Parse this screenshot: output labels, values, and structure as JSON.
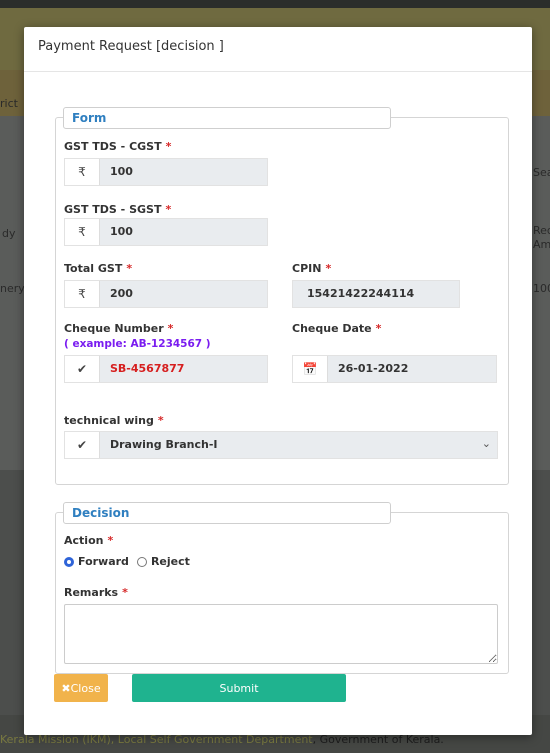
{
  "background": {
    "left_labels": [
      "rict",
      "dy",
      "nery"
    ],
    "right_labels": [
      "Sea",
      "Req",
      "Am",
      "100"
    ],
    "footer": {
      "part1": "Kerala Mission (IKM), Local Self Government Department",
      "part2": ", Government of Kerala."
    }
  },
  "modal": {
    "title": "Payment Request [decision ]",
    "form_legend": "Form",
    "fields": {
      "cgst": {
        "label": "GST TDS - CGST",
        "required": "*",
        "addon": "₹",
        "value": "100"
      },
      "sgst": {
        "label": "GST TDS - SGST",
        "required": "*",
        "addon": "₹",
        "value": "100"
      },
      "total_gst": {
        "label": "Total GST",
        "required": "*",
        "addon": "₹",
        "value": "200"
      },
      "cpin": {
        "label": "CPIN",
        "required": "*",
        "value": "15421422244114"
      },
      "cheque_number": {
        "label": "Cheque Number",
        "required": "*",
        "hint": "( example: AB-1234567 )",
        "addon": "✔",
        "value": "SB-4567877"
      },
      "cheque_date": {
        "label": "Cheque Date",
        "required": "*",
        "addon": "📅",
        "value": "26-01-2022"
      },
      "technical_wing": {
        "label": "technical wing",
        "required": "*",
        "addon": "✔",
        "value": "Drawing Branch-I",
        "chevron": "⌄"
      }
    },
    "decision_legend": "Decision",
    "action": {
      "label": "Action",
      "required": "*",
      "options": [
        "Forward",
        "Reject"
      ],
      "selected": "Forward"
    },
    "remarks": {
      "label": "Remarks",
      "required": "*",
      "value": ""
    },
    "buttons": {
      "close": "✖Close",
      "submit": "Submit"
    }
  },
  "colors": {
    "accent": "#2f7fc0",
    "required": "#d62828",
    "hint": "#7a1cf0",
    "close": "#f1b34b",
    "submit": "#1fb38f"
  }
}
